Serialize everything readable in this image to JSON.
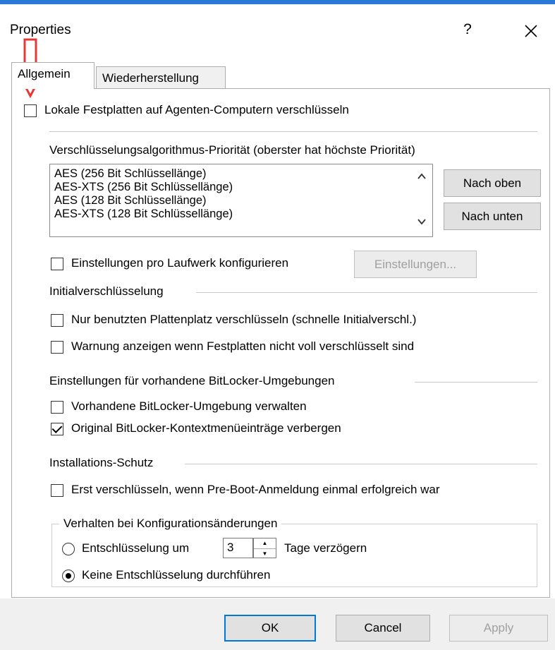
{
  "window": {
    "title": "Properties",
    "help_glyph": "?",
    "close_glyph": "✕"
  },
  "tabs": [
    {
      "label": "Allgemein",
      "active": true
    },
    {
      "label": "Wiederherstellung",
      "active": false
    }
  ],
  "general": {
    "encrypt_local_disks": {
      "label": "Lokale Festplatten auf Agenten-Computern verschlüsseln",
      "checked": false
    },
    "algorithm_priority": {
      "label": "Verschlüsselungsalgorithmus-Priorität (oberster hat höchste Priorität)",
      "items": [
        "AES (256 Bit Schlüssellänge)",
        "AES-XTS (256 Bit Schlüssellänge)",
        "AES (128 Bit Schlüssellänge)",
        "AES-XTS (128 Bit Schlüssellänge)"
      ],
      "move_up": "Nach oben",
      "move_down": "Nach unten"
    },
    "per_drive": {
      "label": "Einstellungen pro Laufwerk konfigurieren",
      "checked": false,
      "button": "Einstellungen..."
    },
    "initial_encryption": {
      "heading": "Initialverschlüsselung",
      "used_space_only": {
        "label": "Nur benutzten Plattenplatz verschlüsseln (schnelle Initialverschl.)",
        "checked": false
      },
      "show_warning": {
        "label": "Warnung anzeigen wenn Festplatten nicht voll verschlüsselt sind",
        "checked": false
      }
    },
    "bitlocker": {
      "heading": "Einstellungen für vorhandene BitLocker-Umgebungen",
      "manage_existing": {
        "label": "Vorhandene BitLocker-Umgebung verwalten",
        "checked": false
      },
      "hide_context_menu": {
        "label": "Original BitLocker-Kontextmenüeinträge verbergen",
        "checked": true
      }
    },
    "install_protection": {
      "heading": "Installations-Schutz",
      "encrypt_after_preboot": {
        "label": "Erst verschlüsseln, wenn Pre-Boot-Anmeldung einmal erfolgreich war",
        "checked": false
      },
      "config_change": {
        "heading": "Verhalten bei Konfigurationsänderungen",
        "delay": {
          "label_before": "Entschlüsselung um",
          "value": "3",
          "label_after": "Tage verzögern",
          "selected": false
        },
        "no_decrypt": {
          "label": "Keine Entschlüsselung durchführen",
          "selected": true
        }
      }
    }
  },
  "footer": {
    "ok": "OK",
    "cancel": "Cancel",
    "apply": "Apply"
  },
  "annotation": {
    "arrow_color": "#e53935"
  }
}
